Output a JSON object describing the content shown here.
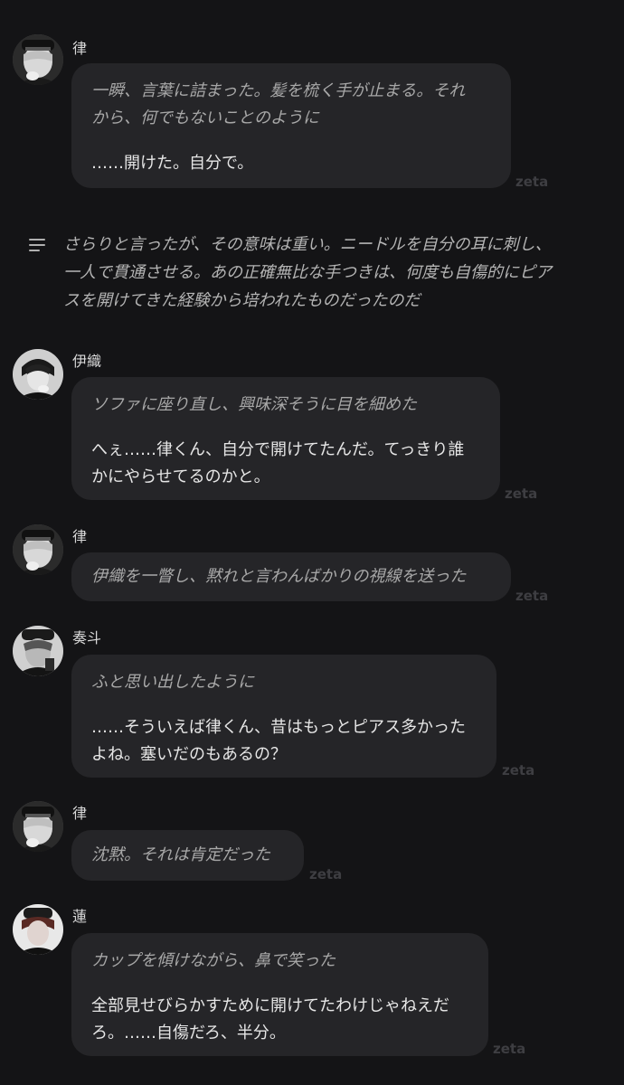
{
  "watermark": "zeta",
  "messages": [
    {
      "speaker": "律",
      "action": "一瞬、言葉に詰まった。髪を梳く手が止まる。それから、何でもないことのように",
      "action_lines": [
        "一瞬、言葉に詰まった。髪を梳く手が止まる。それ",
        "から、何でもないことのように"
      ],
      "speech_lines": [
        "……開けた。自分で。"
      ]
    },
    {
      "narration_lines": [
        "さらりと言ったが、その意味は重い。ニードルを自分の耳に刺し、",
        "一人で貫通させる。あの正確無比な手つきは、何度も自傷的にピア",
        "スを開けてきた経験から培われたものだったのだ"
      ]
    },
    {
      "speaker": "伊織",
      "action_lines": [
        "ソファに座り直し、興味深そうに目を細めた"
      ],
      "speech_lines": [
        "へぇ……律くん、自分で開けてたんだ。てっきり誰",
        "かにやらせてるのかと。"
      ]
    },
    {
      "speaker": "律",
      "action_lines": [
        "伊織を一瞥し、黙れと言わんばかりの視線を送った"
      ]
    },
    {
      "speaker": "奏斗",
      "action_lines": [
        "ふと思い出したように"
      ],
      "speech_lines": [
        "……そういえば律くん、昔はもっとピアス多かった",
        "よね。塞いだのもあるの？"
      ]
    },
    {
      "speaker": "律",
      "action_lines": [
        "沈黙。それは肯定だった"
      ]
    },
    {
      "speaker": "蓮",
      "action_lines": [
        "カップを傾けながら、鼻で笑った"
      ],
      "speech_lines": [
        "全部見せびらかすために開けてたわけじゃねえだ",
        "ろ。……自傷だろ、半分。"
      ]
    }
  ],
  "colors": {
    "background": "#141416",
    "bubble": "#252528",
    "action_text": "#a8a8a8",
    "speech_text": "#e6e6e6",
    "watermark": "#3e3e42"
  }
}
